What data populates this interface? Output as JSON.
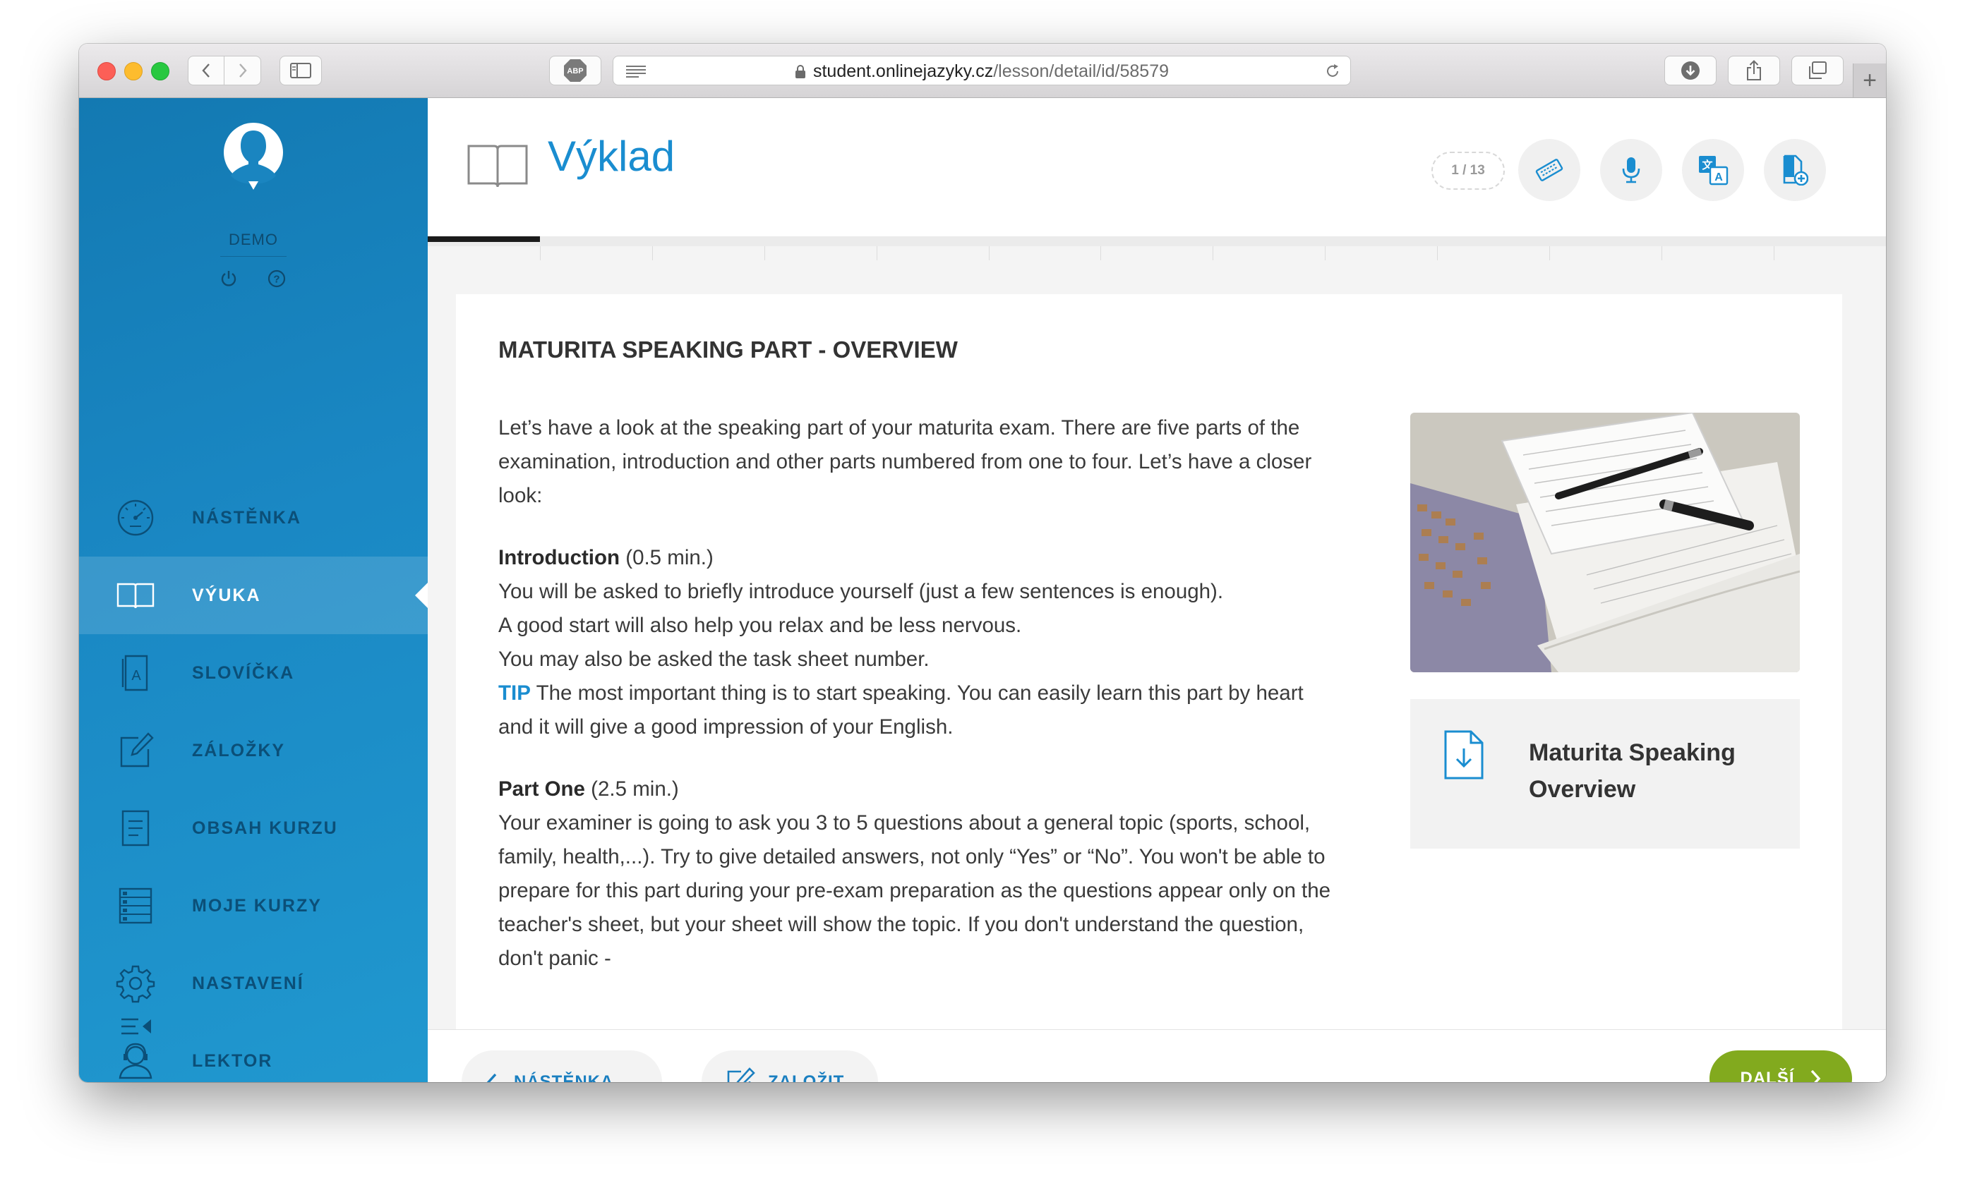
{
  "browser": {
    "url_host": "student.onlinejazyky.cz",
    "url_path": "/lesson/detail/id/58579",
    "abp_label": "ABP"
  },
  "sidebar": {
    "username": "DEMO",
    "items": [
      {
        "label": "NÁSTĚNKA",
        "icon": "dashboard-icon"
      },
      {
        "label": "VÝUKA",
        "icon": "book-icon",
        "active": true
      },
      {
        "label": "SLOVÍČKA",
        "icon": "vocabulary-icon"
      },
      {
        "label": "ZÁLOŽKY",
        "icon": "bookmark-edit-icon"
      },
      {
        "label": "OBSAH KURZU",
        "icon": "document-list-icon"
      },
      {
        "label": "MOJE KURZY",
        "icon": "courses-list-icon"
      },
      {
        "label": "NASTAVENÍ",
        "icon": "gear-icon"
      },
      {
        "label": "LEKTOR",
        "icon": "tutor-icon"
      }
    ]
  },
  "header": {
    "title": "Výklad",
    "pager": "1 / 13",
    "tools": [
      "keyboard-icon",
      "microphone-icon",
      "translate-icon",
      "add-document-icon"
    ]
  },
  "progress": {
    "current": 1,
    "total": 13
  },
  "lesson": {
    "title": "MATURITA SPEAKING PART - OVERVIEW",
    "intro": "Let’s have a look at the speaking part of your maturita exam. There are five parts of the examination, introduction and other parts numbered from one to four. Let’s have a closer look:",
    "introduction": {
      "heading": "Introduction",
      "time": " (0.5 min.)",
      "lines": [
        "You will be asked to briefly introduce yourself (just a few sentences is enough).",
        "A good start will also help you relax and be less nervous.",
        "You may also be asked the task sheet number."
      ],
      "tip_label": "TIP",
      "tip_text": " The most important thing is to start speaking. You can easily learn this part by heart and it will give a good impression of your English."
    },
    "part_one": {
      "heading": "Part One",
      "time": " (2.5 min.)",
      "text": "Your examiner is going to ask you 3 to 5 questions about a general topic (sports, school, family, health,...). Try to give detailed answers, not only “Yes” or “No”. You won't be able to prepare for this part during your pre-exam preparation as the questions appear only on the teacher's sheet, but your sheet will show the topic. If you don't understand the question, don't panic -"
    },
    "download_title": "Maturita Speaking Overview"
  },
  "footer": {
    "back_label": "NÁSTĚNKA",
    "bookmark_label": "ZALOŽIT",
    "next_label": "DALŠÍ"
  },
  "colors": {
    "sidebar": "#1a88c4",
    "accent": "#1a8dd0",
    "next": "#82aa1e"
  }
}
